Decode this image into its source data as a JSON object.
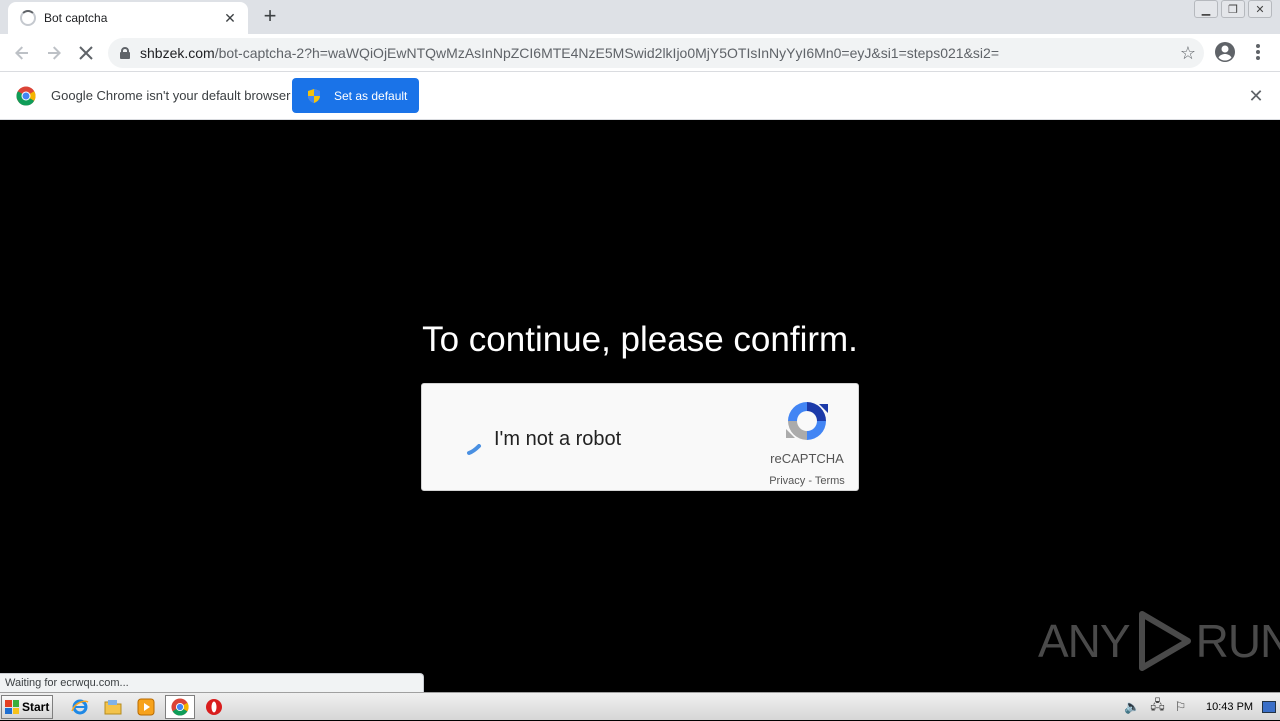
{
  "browser": {
    "tab": {
      "title": "Bot captcha"
    },
    "window_controls": [
      "minimize-icon",
      "restore-icon",
      "close-icon"
    ],
    "url": {
      "host": "shbzek.com",
      "path": "/bot-captcha-2?h=waWQiOjEwNTQwMzAsInNpZCI6MTE4NzE5MSwid2lkIjo0MjY5OTIsInNyYyI6Mn0=eyJ&si1=steps021&si2="
    }
  },
  "infobar": {
    "message": "Google Chrome isn't your default browser",
    "button_label": "Set as default"
  },
  "page": {
    "headline": "To continue, please confirm.",
    "recaptcha": {
      "checkbox_label": "I'm not a robot",
      "brand": "reCAPTCHA",
      "privacy": "Privacy",
      "separator": " - ",
      "terms": "Terms"
    },
    "watermark": {
      "left": "ANY",
      "right": "RUN"
    }
  },
  "status": {
    "text": "Waiting for ecrwqu.com..."
  },
  "taskbar": {
    "start_label": "Start",
    "clock": "10:43 PM",
    "icons": [
      "internet-explorer-icon",
      "file-explorer-icon",
      "media-player-icon",
      "chrome-icon",
      "opera-icon"
    ]
  }
}
